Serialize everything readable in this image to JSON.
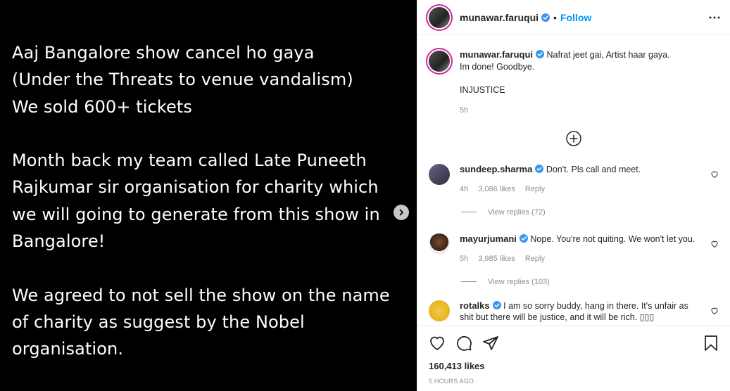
{
  "post": {
    "media_paragraphs": [
      "Aaj Bangalore show cancel ho gaya\n(Under the Threats to venue vandalism)\nWe sold 600+ tickets",
      "Month back my team called Late Puneeth Rajkumar sir organisation for charity which we will going to generate from this show in Bangalore!",
      "We agreed to not sell the show on the name of charity as suggest by the Nobel organisation."
    ]
  },
  "header": {
    "username": "munawar.faruqui",
    "dot": "•",
    "follow_label": "Follow",
    "more_icon": "ellipsis-icon"
  },
  "caption": {
    "username": "munawar.faruqui",
    "text": "Nafrat jeet gai, Artist haar gaya.\nIm done! Goodbye.\n\nINJUSTICE",
    "time": "5h"
  },
  "comments": [
    {
      "username": "sundeep.sharma",
      "text": "Don't. Pls call and meet.",
      "time": "4h",
      "likes": "3,086 likes",
      "reply_label": "Reply",
      "view_replies": "View replies (72)"
    },
    {
      "username": "mayurjumani",
      "text": "Nope. You're not quiting. We won't let you.",
      "time": "5h",
      "likes": "3,985 likes",
      "reply_label": "Reply",
      "view_replies": "View replies (103)"
    },
    {
      "username": "rotalks",
      "text": "I am so sorry buddy, hang in there. It's unfair as shit but there will be justice, and it will be rich. ▯▯▯"
    }
  ],
  "footer": {
    "likes": "160,413 likes",
    "ago": "5 HOURS AGO"
  },
  "colors": {
    "accent": "#0095f6",
    "verified": "#3897f0",
    "muted": "#8e8e8e",
    "media_bg": "#000000"
  }
}
